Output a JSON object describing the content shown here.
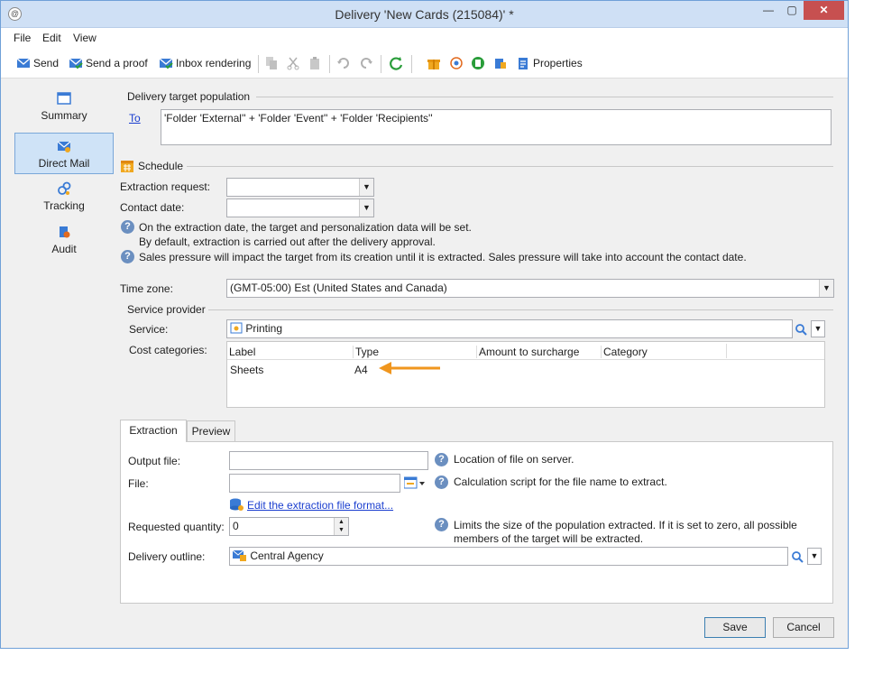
{
  "window": {
    "title": "Delivery 'New Cards (215084)' *",
    "controls": {
      "minimize": "—",
      "maximize": "▢",
      "close": "✕"
    }
  },
  "menu": [
    "File",
    "Edit",
    "View"
  ],
  "toolbar": {
    "send": "Send",
    "send_proof": "Send a proof",
    "inbox_rendering": "Inbox rendering",
    "properties": "Properties"
  },
  "sidebar": {
    "items": [
      {
        "label": "Summary",
        "icon": "summary-icon"
      },
      {
        "label": "Direct Mail",
        "icon": "direct-mail-icon",
        "active": true
      },
      {
        "label": "Tracking",
        "icon": "tracking-icon"
      },
      {
        "label": "Audit",
        "icon": "audit-icon"
      }
    ]
  },
  "target": {
    "section_title": "Delivery target population",
    "to_link": "To",
    "value": "'Folder 'External'' + 'Folder 'Event'' + 'Folder 'Recipients''"
  },
  "schedule": {
    "section_title": "Schedule",
    "extraction_request_label": "Extraction request:",
    "extraction_request_value": "",
    "contact_date_label": "Contact date:",
    "contact_date_value": "",
    "help1_line1": "On the extraction date, the target and personalization data will be set.",
    "help1_line2": "By default, extraction is carried out after the delivery approval.",
    "help2": "Sales pressure will impact the target from its creation until it is extracted. Sales pressure will take into account the contact date."
  },
  "timezone": {
    "label": "Time zone:",
    "value": "(GMT-05:00) Est (United States and Canada)"
  },
  "provider": {
    "section_title": "Service provider",
    "service_label": "Service:",
    "service_value": "Printing",
    "cost_label": "Cost categories:",
    "columns": [
      "Label",
      "Type",
      "Amount to surcharge",
      "Category"
    ],
    "rows": [
      {
        "label": "Sheets",
        "type": "A4",
        "amount": "",
        "category": ""
      }
    ]
  },
  "tabs": {
    "extraction": "Extraction",
    "preview": "Preview"
  },
  "extraction": {
    "output_file_label": "Output file:",
    "output_file_value": "",
    "output_file_help": "Location of file on server.",
    "file_label": "File:",
    "file_value": "",
    "file_help": "Calculation script for the file name to extract.",
    "edit_format_link": "Edit the extraction file format...",
    "quantity_label": "Requested quantity:",
    "quantity_value": "0",
    "quantity_help_line1": "Limits the size of the population extracted. If it is set to zero, all possible",
    "quantity_help_line2": "members of the target will be extracted.",
    "outline_label": "Delivery outline:",
    "outline_value": "Central Agency"
  },
  "buttons": {
    "save": "Save",
    "cancel": "Cancel"
  },
  "colors": {
    "title_bar": "#cfe0f5",
    "close_button": "#c75050",
    "active_sidebar": "#cfe3f7",
    "link": "#1a3ecf",
    "arrow": "#f0961e",
    "help_icon": "#6b8fc0"
  }
}
